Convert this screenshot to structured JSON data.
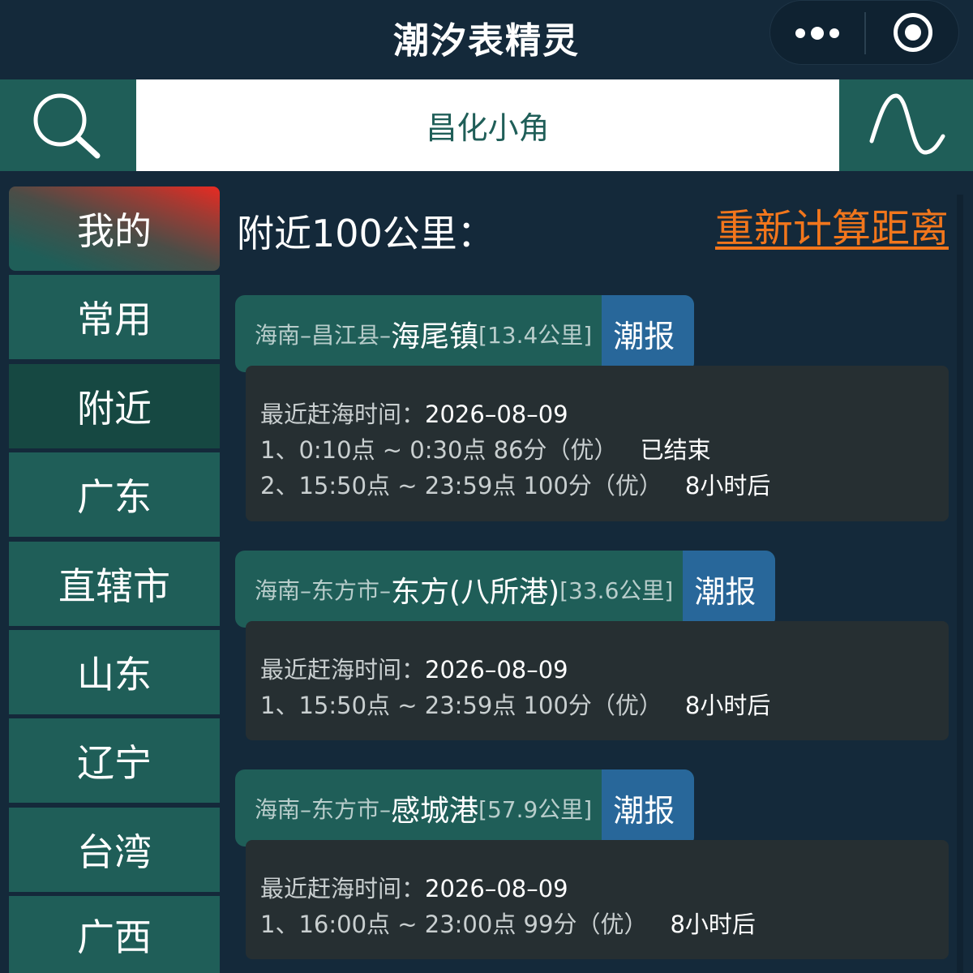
{
  "app": {
    "title": "潮汐表精灵"
  },
  "search": {
    "value": "昌化小角"
  },
  "sidebar": {
    "items": [
      {
        "label": "我的"
      },
      {
        "label": "常用"
      },
      {
        "label": "附近"
      },
      {
        "label": "广东"
      },
      {
        "label": "直辖市"
      },
      {
        "label": "山东"
      },
      {
        "label": "辽宁"
      },
      {
        "label": "台湾"
      },
      {
        "label": "广西"
      }
    ]
  },
  "main": {
    "title": "附近100公里：",
    "recalc_label": "重新计算距离",
    "cards": [
      {
        "prov": "海南–昌江县–",
        "name": "海尾镇",
        "dist": "[13.4公里]",
        "btn": "潮报",
        "date_label": "最近赶海时间：",
        "date": "2026–08–09",
        "slots": [
          {
            "text": "1、0:10点 ~ 0:30点 86分（优）",
            "status": "已结束"
          },
          {
            "text": "2、15:50点 ~ 23:59点 100分（优）",
            "status": "8小时后"
          }
        ]
      },
      {
        "prov": "海南–东方市–",
        "name": "东方(八所港)",
        "dist": "[33.6公里]",
        "btn": "潮报",
        "date_label": "最近赶海时间：",
        "date": "2026–08–09",
        "slots": [
          {
            "text": "1、15:50点 ~ 23:59点 100分（优）",
            "status": "8小时后"
          }
        ]
      },
      {
        "prov": "海南–东方市–",
        "name": "感城港",
        "dist": "[57.9公里]",
        "btn": "潮报",
        "date_label": "最近赶海时间：",
        "date": "2026–08–09",
        "slots": [
          {
            "text": "1、16:00点 ~ 23:00点 99分（优）",
            "status": "8小时后"
          }
        ]
      }
    ]
  },
  "icons": {
    "search": "search-icon",
    "tide_curve": "wave-icon",
    "more": "more-dots-icon",
    "close": "target-icon"
  }
}
